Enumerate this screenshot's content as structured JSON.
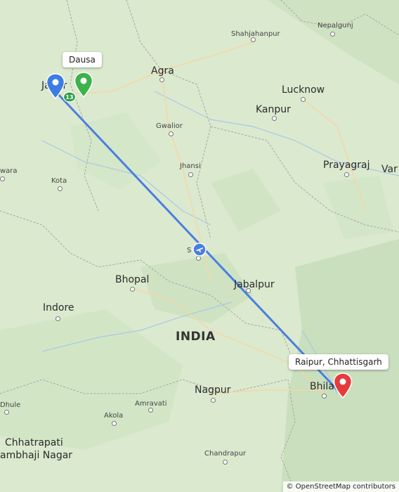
{
  "map": {
    "country_label": "INDIA",
    "cities_major": {
      "agra": "Agra",
      "lucknow": "Lucknow",
      "kanpur": "Kanpur",
      "prayagraj": "Prayagraj",
      "var": "Var",
      "bhopal": "Bhopal",
      "indore": "Indore",
      "jabalpur": "Jabalpur",
      "nagpur": "Nagpur",
      "bhilai": "Bhila",
      "jaipur": "Ja  ur",
      "chhatrapati_1": "Chhatrapati",
      "chhatrapati_2": "ambhaji Nagar"
    },
    "cities_minor": {
      "shahjahanpur": "Shahjahanpur",
      "nepalgunj": "Nepalgunj",
      "gwalior": "Gwalior",
      "jhansi": "Jhansi",
      "kota": "Kota",
      "wara": "wara",
      "sagar": "S   r",
      "amravati": "Amravati",
      "akola": "Akola",
      "dhule": "Dhule",
      "chandrapur": "Chandrapur"
    },
    "origin_callout": "Dausa",
    "destination_callout": "Raipur, Chhattisgarh",
    "attribution": "© OpenStreetMap contributors",
    "colors": {
      "route": "#4a7fe0",
      "origin_pin": "#3b7de4",
      "waypoint_pin": "#3cb34a",
      "destination_pin": "#e53b3b",
      "highway_shield": "#2e9e4a"
    },
    "icons": {
      "airport": "airplane-icon",
      "highway_shield": "highway-shield-icon"
    },
    "highway_shield_text": "13"
  }
}
